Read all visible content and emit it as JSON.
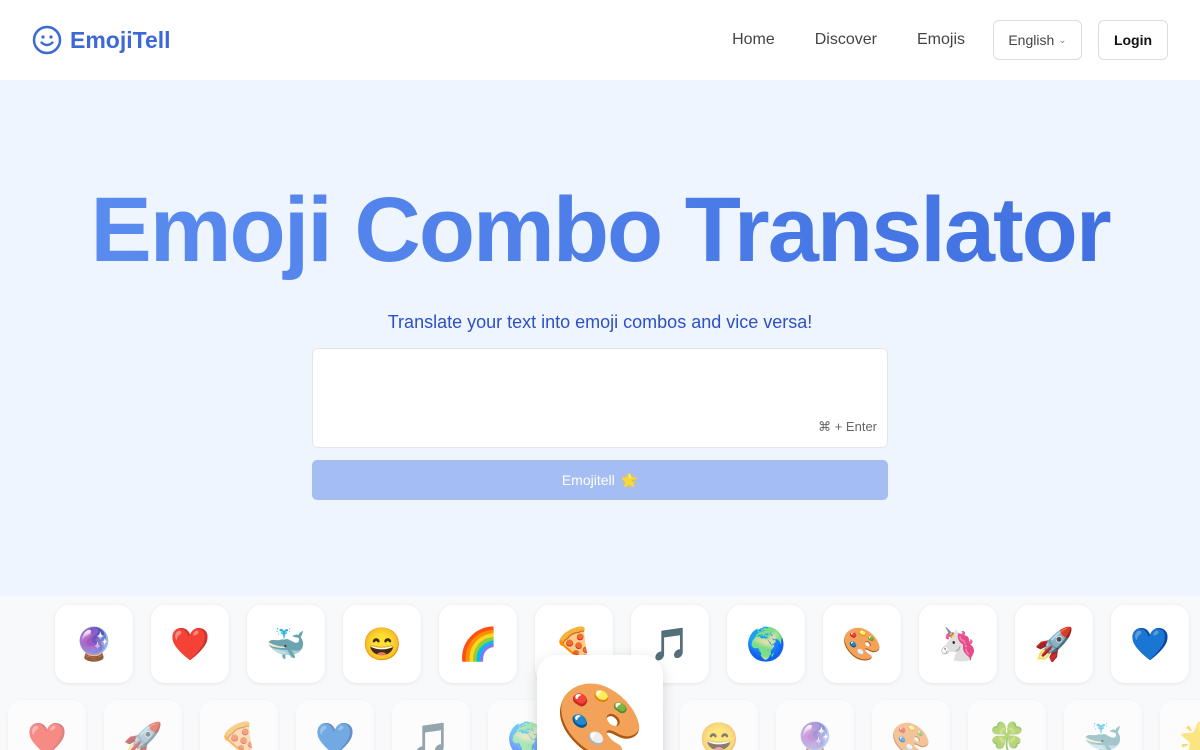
{
  "header": {
    "brand": "EmojiTell",
    "nav": [
      "Home",
      "Discover",
      "Emojis"
    ],
    "language": "English",
    "login": "Login"
  },
  "hero": {
    "title": "Emoji Combo Translator",
    "subtitle": "Translate your text into emoji combos and vice versa!",
    "input_value": "",
    "shortcut_hint": "⌘ + Enter",
    "submit_label": "Emojitell",
    "submit_emoji": "🌟"
  },
  "emoji_row_1": [
    "🔮",
    "❤️",
    "🐳",
    "😄",
    "🌈",
    "🍕",
    "🎵",
    "🌍",
    "🎨",
    "🦄",
    "🚀",
    "💙"
  ],
  "emoji_row_2": [
    "❤️",
    "🚀",
    "🍕",
    "💙",
    "🎵",
    "🌍",
    "😄",
    "😄",
    "🔮",
    "🎨",
    "🍀",
    "🐳",
    "🌟"
  ],
  "featured_emoji": "🎨",
  "colors": {
    "brand": "#3d68d8",
    "hero_bg": "#eff5fe",
    "button": "#a4bdf3"
  }
}
